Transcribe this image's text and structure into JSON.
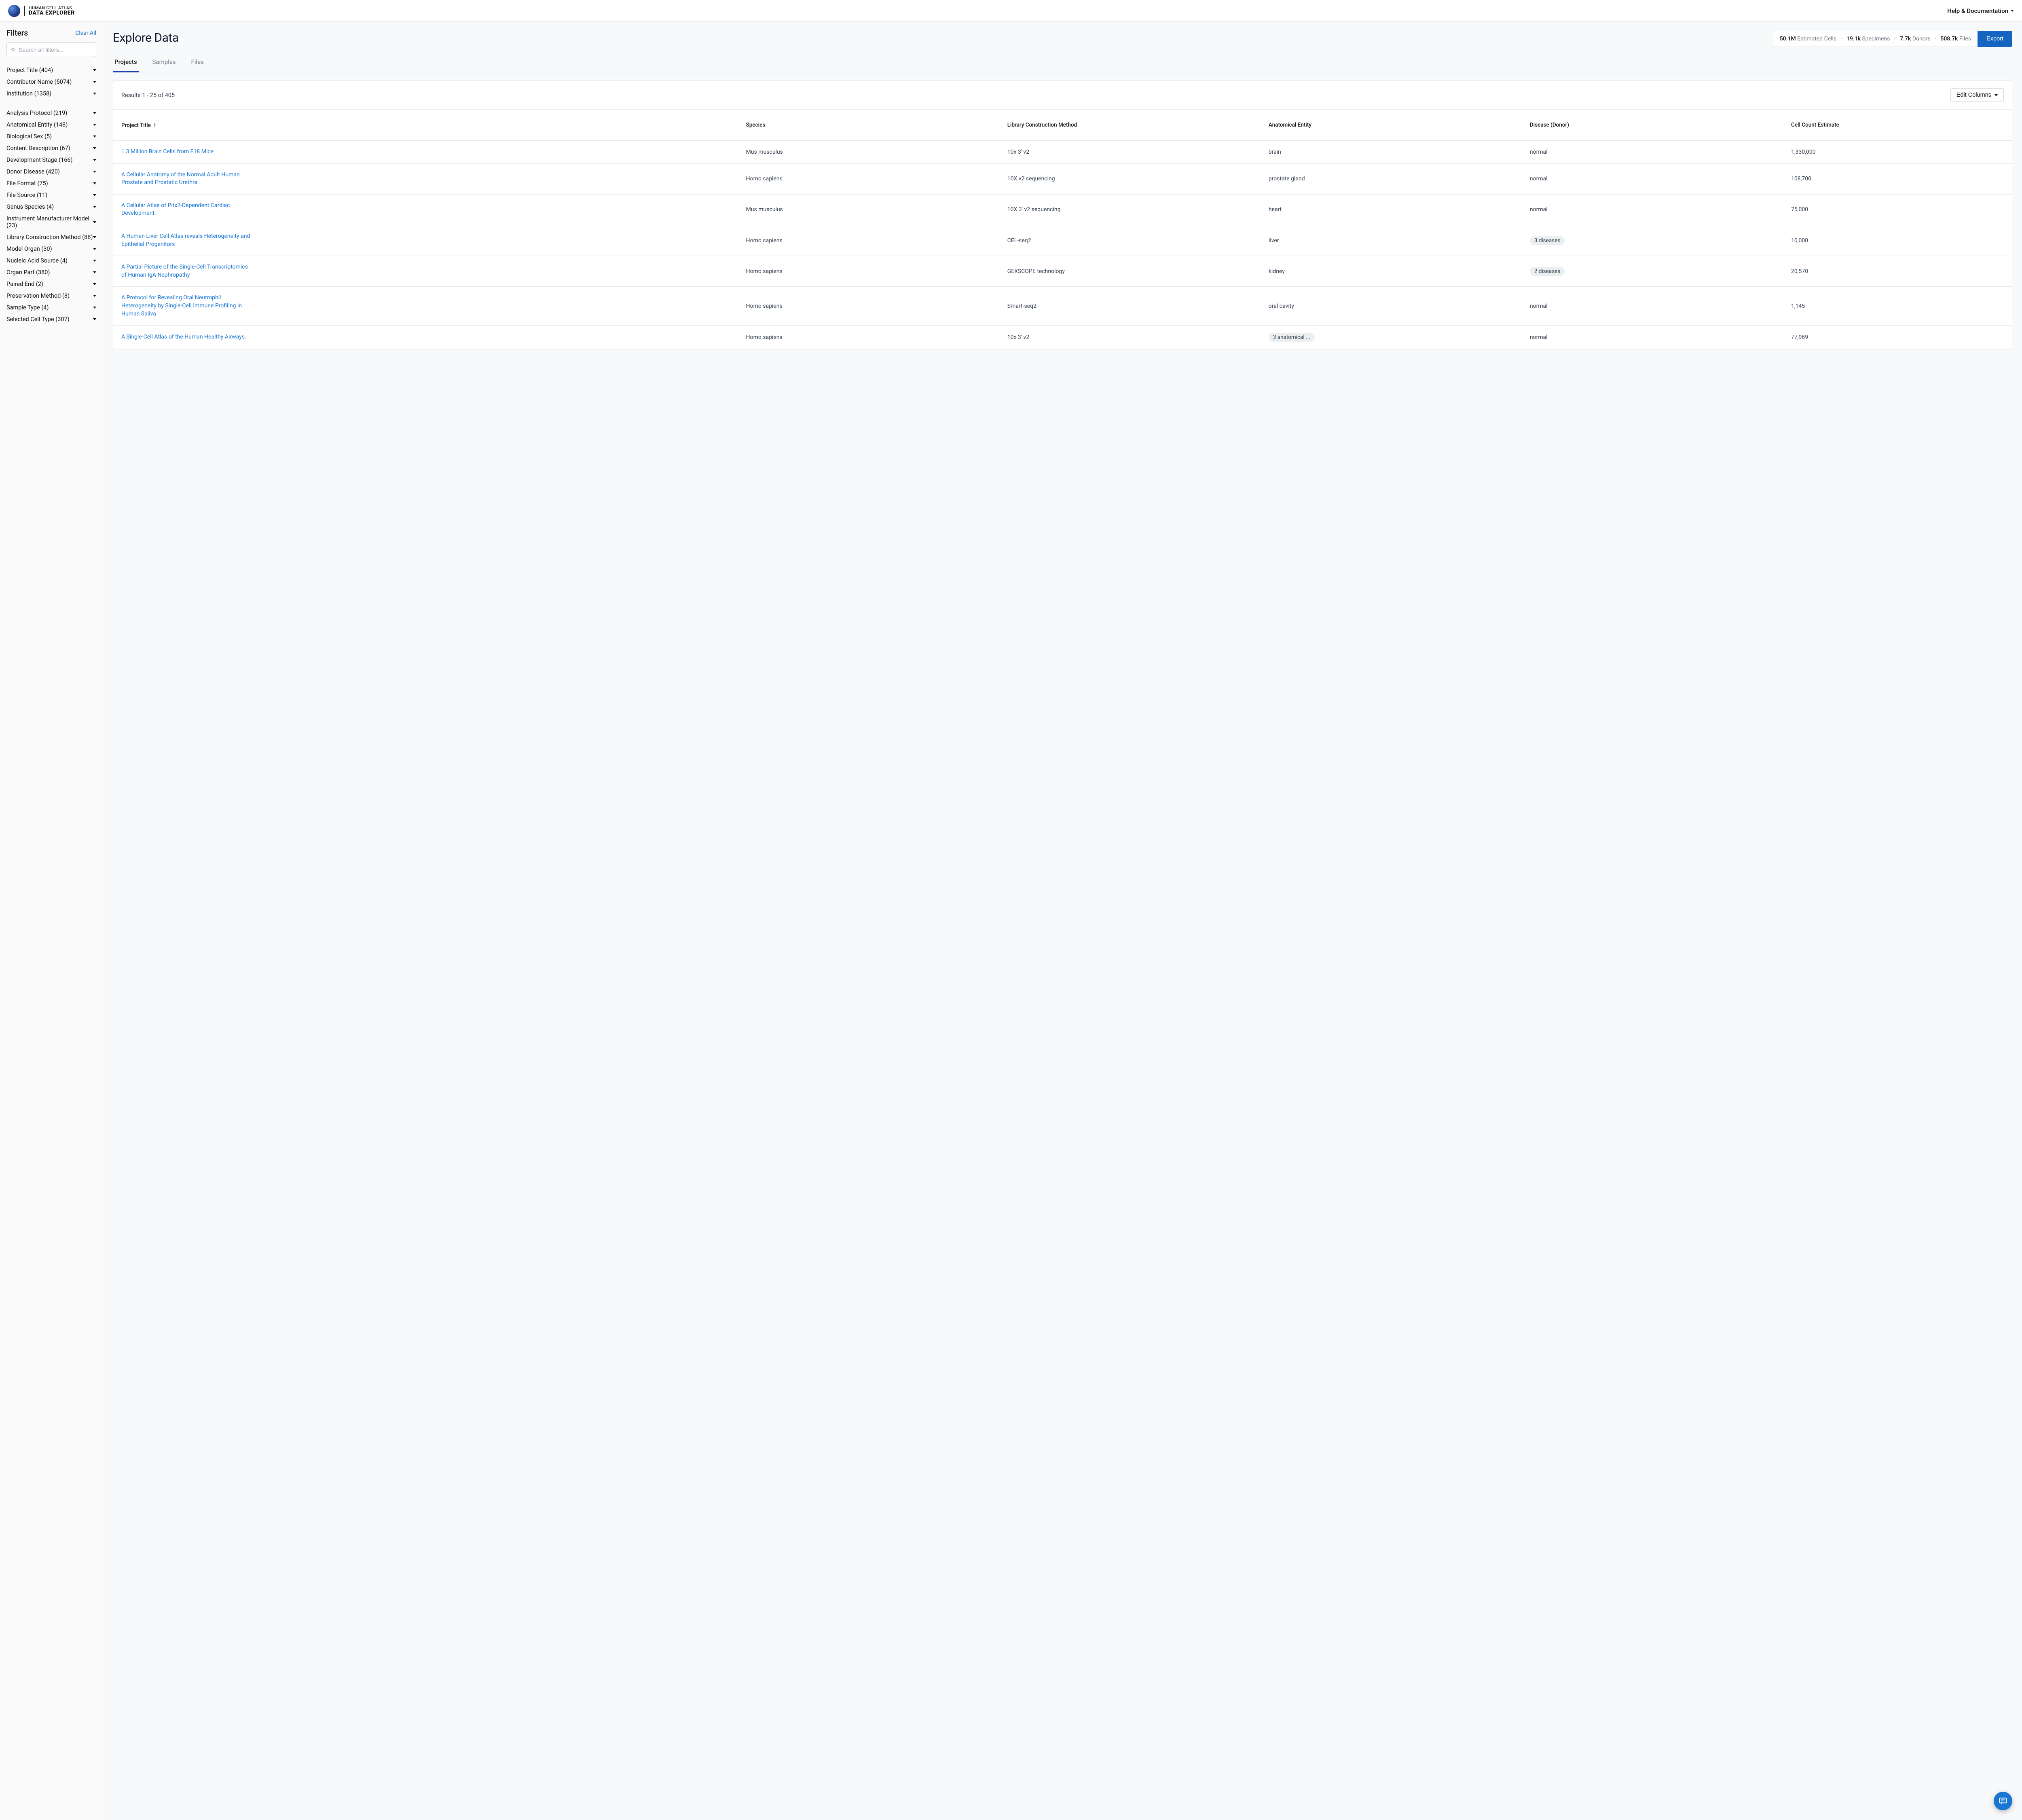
{
  "brand": {
    "line1": "HUMAN CELL ATLAS",
    "line2": "DATA EXPLORER"
  },
  "help_link": "Help & Documentation",
  "sidebar": {
    "title": "Filters",
    "clear_all": "Clear All",
    "search_placeholder": "Search all filters...",
    "group1": [
      "Project Title (404)",
      "Contributor Name (5074)",
      "Institution (1358)"
    ],
    "group2": [
      "Analysis Protocol (219)",
      "Anatomical Entity (148)",
      "Biological Sex (5)",
      "Content Description (67)",
      "Development Stage (166)",
      "Donor Disease (420)",
      "File Format (75)",
      "File Source (11)",
      "Genus Species (4)",
      "Instrument Manufacturer Model (23)",
      "Library Construction Method (88)",
      "Model Organ (30)",
      "Nucleic Acid Source (4)",
      "Organ Part (380)",
      "Paired End (2)",
      "Preservation Method (8)",
      "Sample Type (4)",
      "Selected Cell Type (307)"
    ]
  },
  "page": {
    "title": "Explore Data",
    "stats": [
      {
        "num": "50.1M",
        "lbl": "Estimated Cells"
      },
      {
        "num": "19.1k",
        "lbl": "Specimens"
      },
      {
        "num": "7.7k",
        "lbl": "Donors"
      },
      {
        "num": "508.7k",
        "lbl": "Files"
      }
    ],
    "export_label": "Export",
    "tabs": [
      {
        "label": "Projects",
        "active": true
      },
      {
        "label": "Samples",
        "active": false
      },
      {
        "label": "Files",
        "active": false
      }
    ],
    "results_text": "Results 1 - 25 of 405",
    "edit_columns_label": "Edit Columns",
    "columns": [
      "Project Title",
      "Species",
      "Library Construction Method",
      "Anatomical Entity",
      "Disease (Donor)",
      "Cell Count Estimate"
    ],
    "rows": [
      {
        "title": "1.3 Million Brain Cells from E18 Mice",
        "species": "Mus musculus",
        "lib": "10x 3' v2",
        "anat": "brain",
        "disease": "normal",
        "count": "1,330,000"
      },
      {
        "title": "A Cellular Anatomy of the Normal Adult Human Prostate and Prostatic Urethra",
        "species": "Homo sapiens",
        "lib": "10X v2 sequencing",
        "anat": "prostate gland",
        "disease": "normal",
        "count": "108,700"
      },
      {
        "title": "A Cellular Atlas of Pitx2-Dependent Cardiac Development.",
        "species": "Mus musculus",
        "lib": "10X 3' v2 sequencing",
        "anat": "heart",
        "disease": "normal",
        "count": "75,000"
      },
      {
        "title": "A Human Liver Cell Atlas reveals Heterogeneity and Epithelial Progenitors",
        "species": "Homo sapiens",
        "lib": "CEL-seq2",
        "anat": "liver",
        "disease_chip": "3 diseases",
        "count": "10,000"
      },
      {
        "title": "A Partial Picture of the Single-Cell Transcriptomics of Human IgA Nephropathy",
        "species": "Homo sapiens",
        "lib": "GEXSCOPE technology",
        "anat": "kidney",
        "disease_chip": "2 diseases",
        "count": "20,570"
      },
      {
        "title": "A Protocol for Revealing Oral Neutrophil Heterogeneity by Single-Cell Immune Profiling in Human Saliva",
        "species": "Homo sapiens",
        "lib": "Smart-seq2",
        "anat": "oral cavity",
        "disease": "normal",
        "count": "1,145"
      },
      {
        "title": "A Single-Cell Atlas of the Human Healthy Airways.",
        "species": "Homo sapiens",
        "lib": "10x 3' v2",
        "anat_chip": "3 anatomical ...",
        "disease": "normal",
        "count": "77,969"
      }
    ]
  }
}
